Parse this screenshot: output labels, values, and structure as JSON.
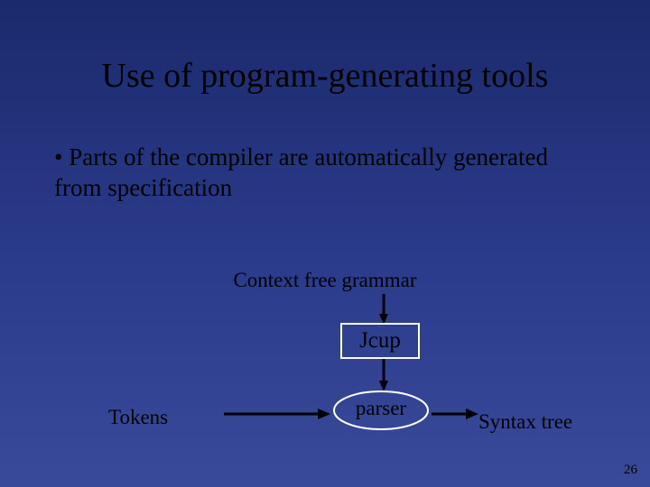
{
  "slide": {
    "title": "Use of program-generating tools",
    "bullet": "Parts of the compiler are automatically generated from specification",
    "context_label": "Context free grammar",
    "tool_box": "Jcup",
    "parser_label": "parser",
    "tokens_label": "Tokens",
    "syntax_label": "Syntax tree",
    "page_number": "26"
  }
}
